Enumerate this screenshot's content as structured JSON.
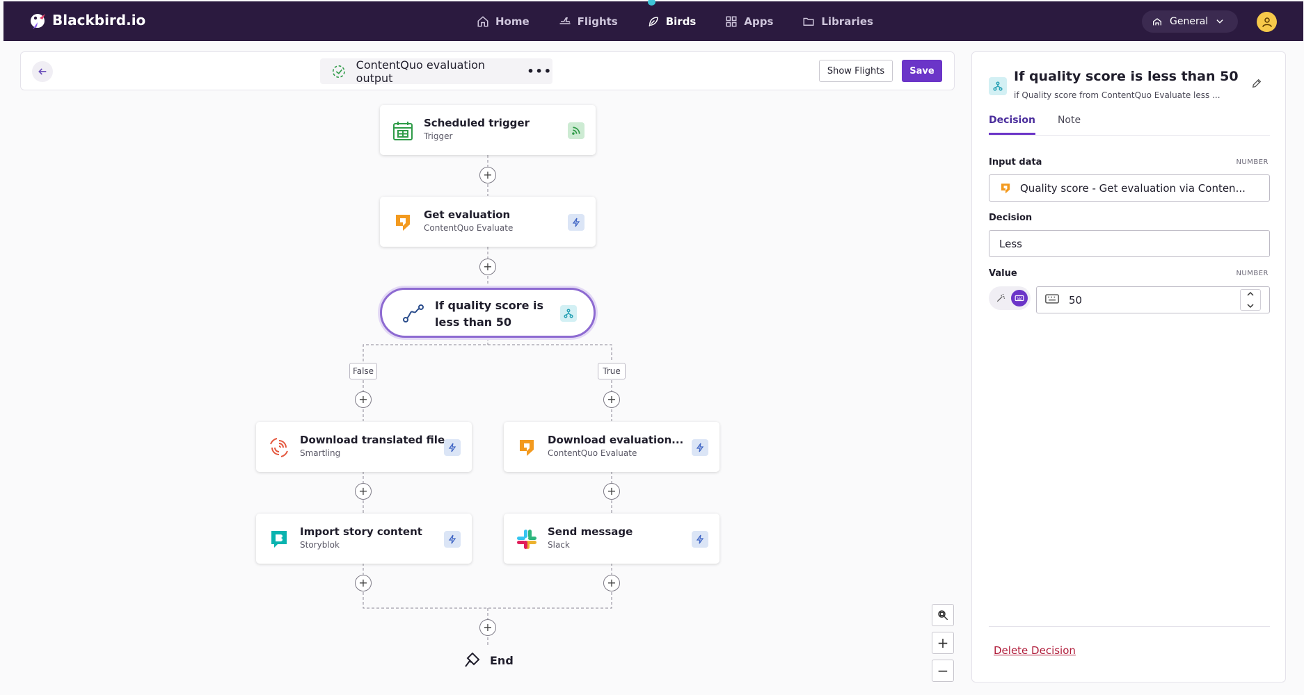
{
  "brand": {
    "name": "Blackbird.io"
  },
  "nav": {
    "items": [
      {
        "label": "Home",
        "icon": "home-icon"
      },
      {
        "label": "Flights",
        "icon": "plane-icon"
      },
      {
        "label": "Birds",
        "icon": "feather-icon",
        "active": true
      },
      {
        "label": "Apps",
        "icon": "grid-icon"
      },
      {
        "label": "Libraries",
        "icon": "folder-icon"
      }
    ],
    "workspace": "General"
  },
  "header": {
    "title": "ContentQuo evaluation output",
    "more": "•••",
    "show_flights": "Show Flights",
    "save": "Save"
  },
  "flow": {
    "trigger": {
      "title": "Scheduled trigger",
      "subtitle": "Trigger"
    },
    "get_eval": {
      "title": "Get evaluation",
      "subtitle": "ContentQuo Evaluate"
    },
    "decision": {
      "title": "If quality score is less than 50"
    },
    "false_label": "False",
    "true_label": "True",
    "false_branch": [
      {
        "title": "Download translated file",
        "subtitle": "Smartling"
      },
      {
        "title": "Import story content",
        "subtitle": "Storyblok"
      }
    ],
    "true_branch": [
      {
        "title": "Download evaluation...",
        "subtitle": "ContentQuo Evaluate"
      },
      {
        "title": "Send message",
        "subtitle": "Slack"
      }
    ],
    "end": "End",
    "plus": "+"
  },
  "zoom": {
    "in": "+",
    "out": "−"
  },
  "panel": {
    "title": "If quality score is less than 50",
    "subtitle": "if Quality score from ContentQuo Evaluate less ...",
    "tabs": [
      "Decision",
      "Note"
    ],
    "input_label": "Input data",
    "input_type": "NUMBER",
    "input_value": "Quality score - Get evaluation via Conten...",
    "decision_label": "Decision",
    "decision_value": "Less",
    "value_label": "Value",
    "value_type": "NUMBER",
    "value": "50",
    "delete": "Delete Decision"
  },
  "colors": {
    "nav_bg": "#2b1a3f",
    "accent": "#6b35c8",
    "decision_border": "#8d6ad1",
    "delete": "#b01c3a"
  }
}
